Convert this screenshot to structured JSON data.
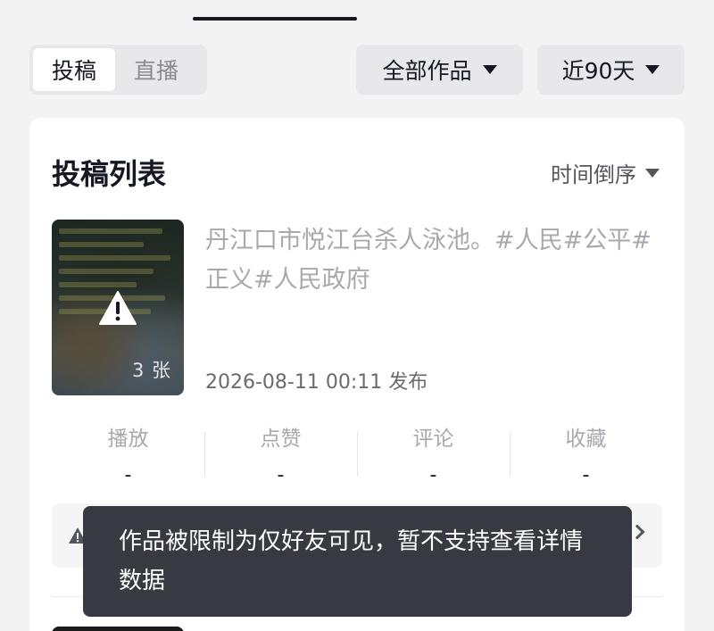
{
  "tabs": [
    {
      "label": "投稿",
      "active": true
    },
    {
      "label": "直播",
      "active": false
    }
  ],
  "filters": {
    "works": "全部作品",
    "range": "近90天"
  },
  "card": {
    "title": "投稿列表",
    "sort_label": "时间倒序"
  },
  "post": {
    "title": "丹江口市悦江台杀人泳池。#人民#公平#正义#人民政府",
    "time": "2026-08-11 00:11 发布",
    "image_count": "3 张",
    "thumbnail_icon": "warning-triangle-icon"
  },
  "stats": [
    {
      "label": "播放",
      "value": "-"
    },
    {
      "label": "点赞",
      "value": "-"
    },
    {
      "label": "评论",
      "value": "-"
    },
    {
      "label": "收藏",
      "value": "-"
    }
  ],
  "toast": {
    "message": "作品被限制为仅好友可见，暂不支持查看详情数据"
  },
  "colors": {
    "background": "#f3f3f4",
    "card": "#ffffff",
    "toast_bg": "#373a40",
    "muted_text": "#a8a9ae",
    "primary_text": "#161823"
  }
}
